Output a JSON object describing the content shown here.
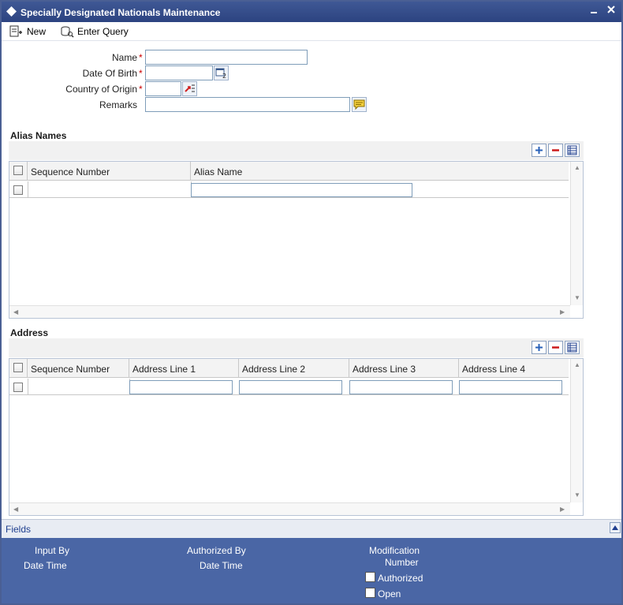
{
  "window": {
    "title": "Specially Designated Nationals Maintenance"
  },
  "toolbar": {
    "new_label": "New",
    "enter_query_label": "Enter Query"
  },
  "form": {
    "name_label": "Name",
    "dob_label": "Date Of Birth",
    "country_label": "Country of Origin",
    "remarks_label": "Remarks",
    "required_mark": "*",
    "name_value": "",
    "dob_value": "",
    "country_value": "",
    "remarks_value": ""
  },
  "alias_section": {
    "title": "Alias Names",
    "columns": [
      "Sequence Number",
      "Alias Name"
    ],
    "rows": [
      {
        "sequence_number": "",
        "alias_name": ""
      }
    ]
  },
  "address_section": {
    "title": "Address",
    "columns": [
      "Sequence Number",
      "Address Line 1",
      "Address Line 2",
      "Address Line 3",
      "Address Line 4"
    ],
    "rows": [
      {
        "sequence_number": "",
        "line1": "",
        "line2": "",
        "line3": "",
        "line4": ""
      }
    ]
  },
  "fields_bar": {
    "label": "Fields"
  },
  "footer": {
    "input_by": "Input By",
    "date_time_1": "Date Time",
    "authorized_by": "Authorized By",
    "date_time_2": "Date Time",
    "modification": "Modification",
    "number": "Number",
    "authorized": "Authorized",
    "open": "Open",
    "authorized_checked": false,
    "open_checked": false
  },
  "colors": {
    "titlebar": "#2c4380",
    "footer": "#4a66a5",
    "required": "#cc0000",
    "link": "#1f3f8f"
  },
  "icons": [
    "window-logo-icon",
    "minimize-icon",
    "close-icon",
    "new-icon",
    "enter-query-icon",
    "calendar-icon",
    "lov-icon",
    "remarks-icon",
    "add-row-icon",
    "delete-row-icon",
    "single-view-icon",
    "collapse-up-icon"
  ]
}
